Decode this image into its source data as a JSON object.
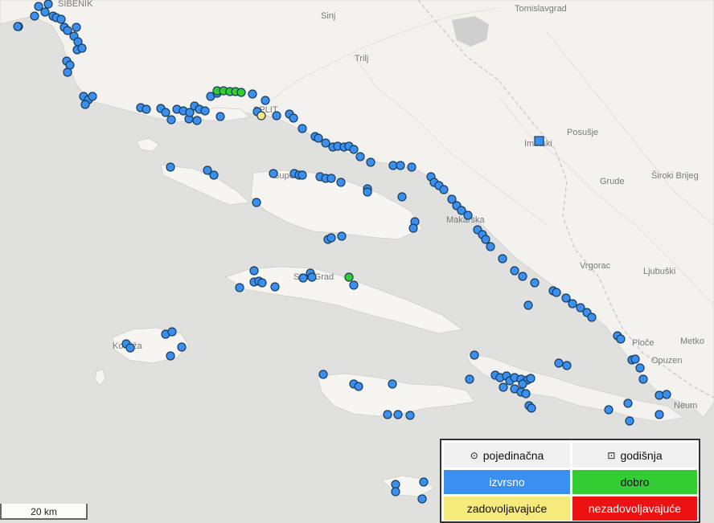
{
  "map": {
    "place_labels": {
      "sinj": "Sinj",
      "trilj": "Trilj",
      "tomislavgrad": "Tomislavgrad",
      "posusje": "Posušje",
      "imotski": "Imotski",
      "grude": "Grude",
      "siroki_brijeg": "Široki Brijeg",
      "makarska": "Makarska",
      "vrgorac": "Vrgorac",
      "ljubuski": "Ljubuški",
      "ploce": "Ploče",
      "opuzen": "Opuzen",
      "metkovic": "Metko",
      "neum": "Neum",
      "stari_grad": "Stari Grad",
      "komiza": "Komiža",
      "split": "SPLIT",
      "supetar": "Supetar",
      "sibenik": "ŠIBENIK"
    },
    "station_colors": {
      "izvrsno": "#3a8fef",
      "dobro": "#33cc33",
      "zadovoljavajuce": "#f7ea7c",
      "nezadovoljavajuce": "#ee1111"
    }
  },
  "legend": {
    "type_single": "pojedinačna",
    "type_annual": "godišnja",
    "single_symbol": "⊙",
    "annual_symbol": "⊡",
    "excellent": "izvrsno",
    "good": "dobro",
    "satisfactory": "zadovoljavajuće",
    "unsatisfactory": "nezadovoljavajuće",
    "excellent_color": "#3a8fef",
    "good_color": "#33cc33",
    "satisfactory_color": "#f7ea7c",
    "unsatisfactory_color": "#ee1111"
  },
  "scale": {
    "label": "20 km"
  }
}
